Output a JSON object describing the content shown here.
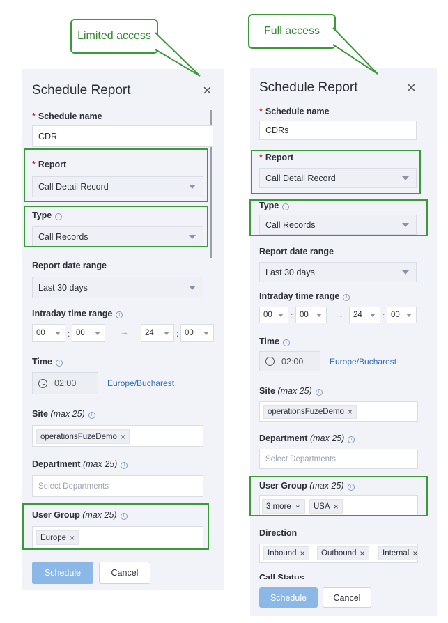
{
  "callouts": {
    "left": "Limited access",
    "right": "Full access"
  },
  "left_panel": {
    "title": "Schedule Report",
    "schedule_name_label": "Schedule name",
    "schedule_name_value": "CDR",
    "report_label": "Report",
    "report_value": "Call Detail Record",
    "type_label": "Type",
    "type_value": "Call Records",
    "date_range_label": "Report date range",
    "date_range_value": "Last 30 days",
    "intraday_label": "Intraday time range",
    "intraday": {
      "start_h": "00",
      "start_m": "00",
      "end_h": "24",
      "end_m": "00",
      "sep": ":",
      "arrow": "→"
    },
    "time_label": "Time",
    "time_value": "02:00",
    "timezone": "Europe/Bucharest",
    "site_label": "Site",
    "site_hint": "(max 25)",
    "site_tag": "operationsFuzeDemo",
    "department_label": "Department",
    "department_hint": "(max 25)",
    "department_placeholder": "Select Departments",
    "user_group_label": "User Group",
    "user_group_hint": "(max 25)",
    "user_group_tag": "Europe",
    "schedule_button": "Schedule",
    "cancel_button": "Cancel"
  },
  "right_panel": {
    "title": "Schedule Report",
    "schedule_name_label": "Schedule name",
    "schedule_name_value": "CDRs",
    "report_label": "Report",
    "report_value": "Call Detail Record",
    "type_label": "Type",
    "type_value": "Call Records",
    "date_range_label": "Report date range",
    "date_range_value": "Last 30 days",
    "intraday_label": "Intraday time range",
    "intraday": {
      "start_h": "00",
      "start_m": "00",
      "end_h": "24",
      "end_m": "00",
      "sep": ":",
      "arrow": "→"
    },
    "time_label": "Time",
    "time_value": "02:00",
    "timezone": "Europe/Bucharest",
    "site_label": "Site",
    "site_hint": "(max 25)",
    "site_tag": "operationsFuzeDemo",
    "department_label": "Department",
    "department_hint": "(max 25)",
    "department_placeholder": "Select Departments",
    "user_group_label": "User Group",
    "user_group_hint": "(max 25)",
    "user_group_more": "3 more",
    "user_group_tag": "USA",
    "direction_label": "Direction",
    "direction_tags": [
      "Inbound",
      "Outbound",
      "Internal"
    ],
    "call_status_label": "Call Status",
    "schedule_button": "Schedule",
    "cancel_button": "Cancel"
  },
  "icons": {
    "close": "×",
    "tag_remove": "×",
    "info": "i",
    "chevron": "⌄"
  },
  "colors": {
    "highlight": "#3a9a3a",
    "primary_button": "#8cb8e8",
    "link": "#2f6fb5",
    "required": "#d32f2f"
  }
}
